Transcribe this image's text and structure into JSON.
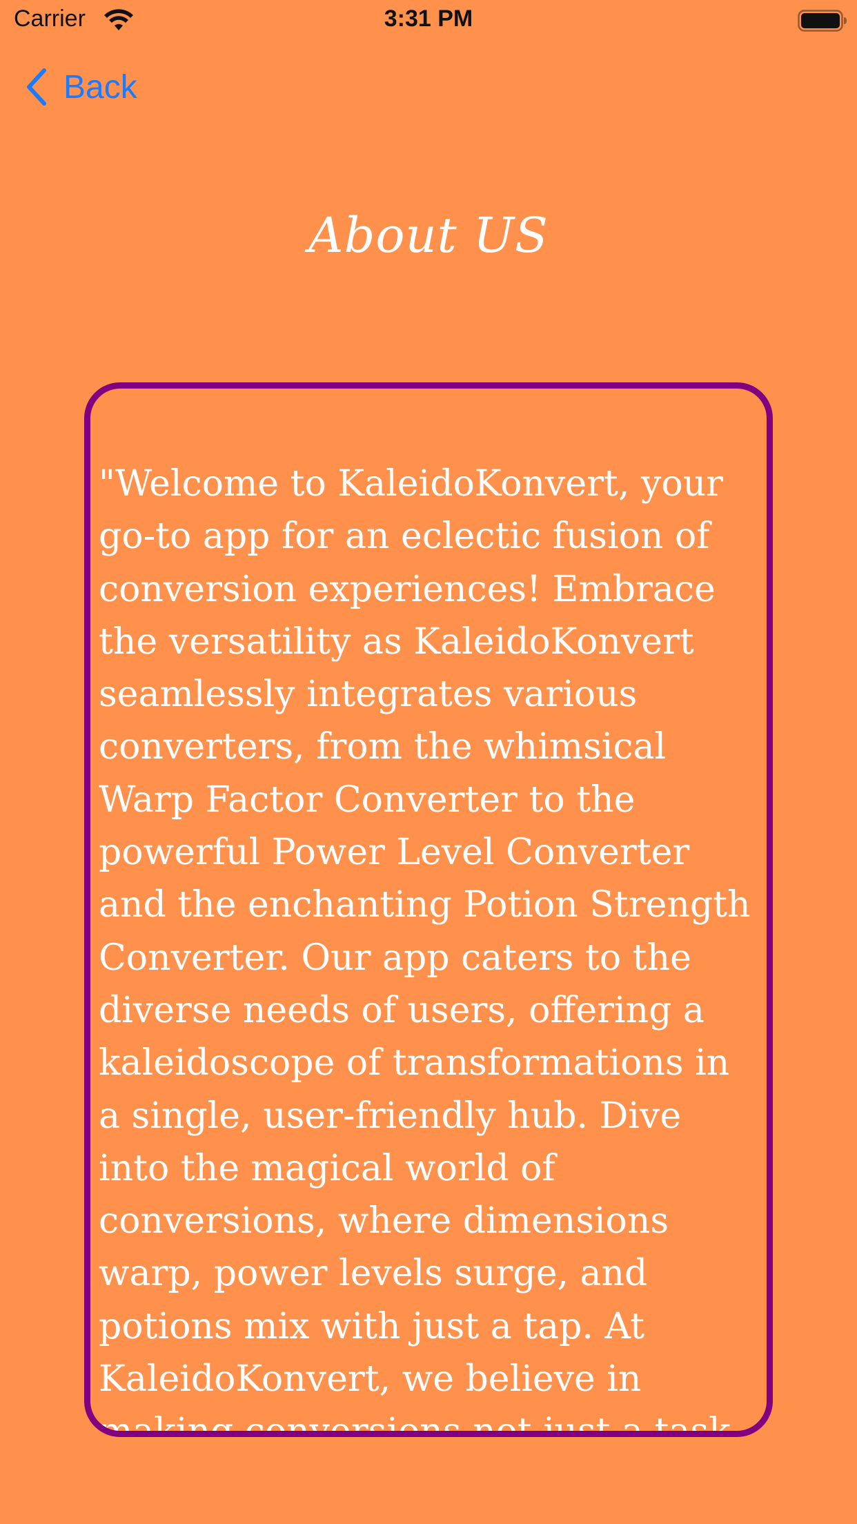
{
  "status_bar": {
    "carrier": "Carrier",
    "time": "3:31 PM"
  },
  "nav": {
    "back_label": "Back"
  },
  "page": {
    "title": "About US"
  },
  "about": {
    "text": "\"Welcome to KaleidoKonvert, your go-to app for an eclectic fusion of conversion experiences! Embrace the versatility as KaleidoKonvert seamlessly integrates various converters, from the whimsical Warp Factor Converter to the powerful Power Level Converter and the enchanting Potion Strength Converter. Our app caters to the diverse needs of users, offering a kaleidoscope of transformations in a single, user-friendly hub. Dive into the magical world of conversions, where dimensions warp, power levels surge, and potions mix with just a tap. At KaleidoKonvert, we believe in making conversions not just a task"
  },
  "colors": {
    "background": "#FF914D",
    "card_border": "#800080",
    "link": "#1A7BFF",
    "text": "#FFFFFF"
  },
  "icons": {
    "wifi": "wifi-icon",
    "battery": "battery-icon",
    "back": "chevron-left-icon"
  }
}
